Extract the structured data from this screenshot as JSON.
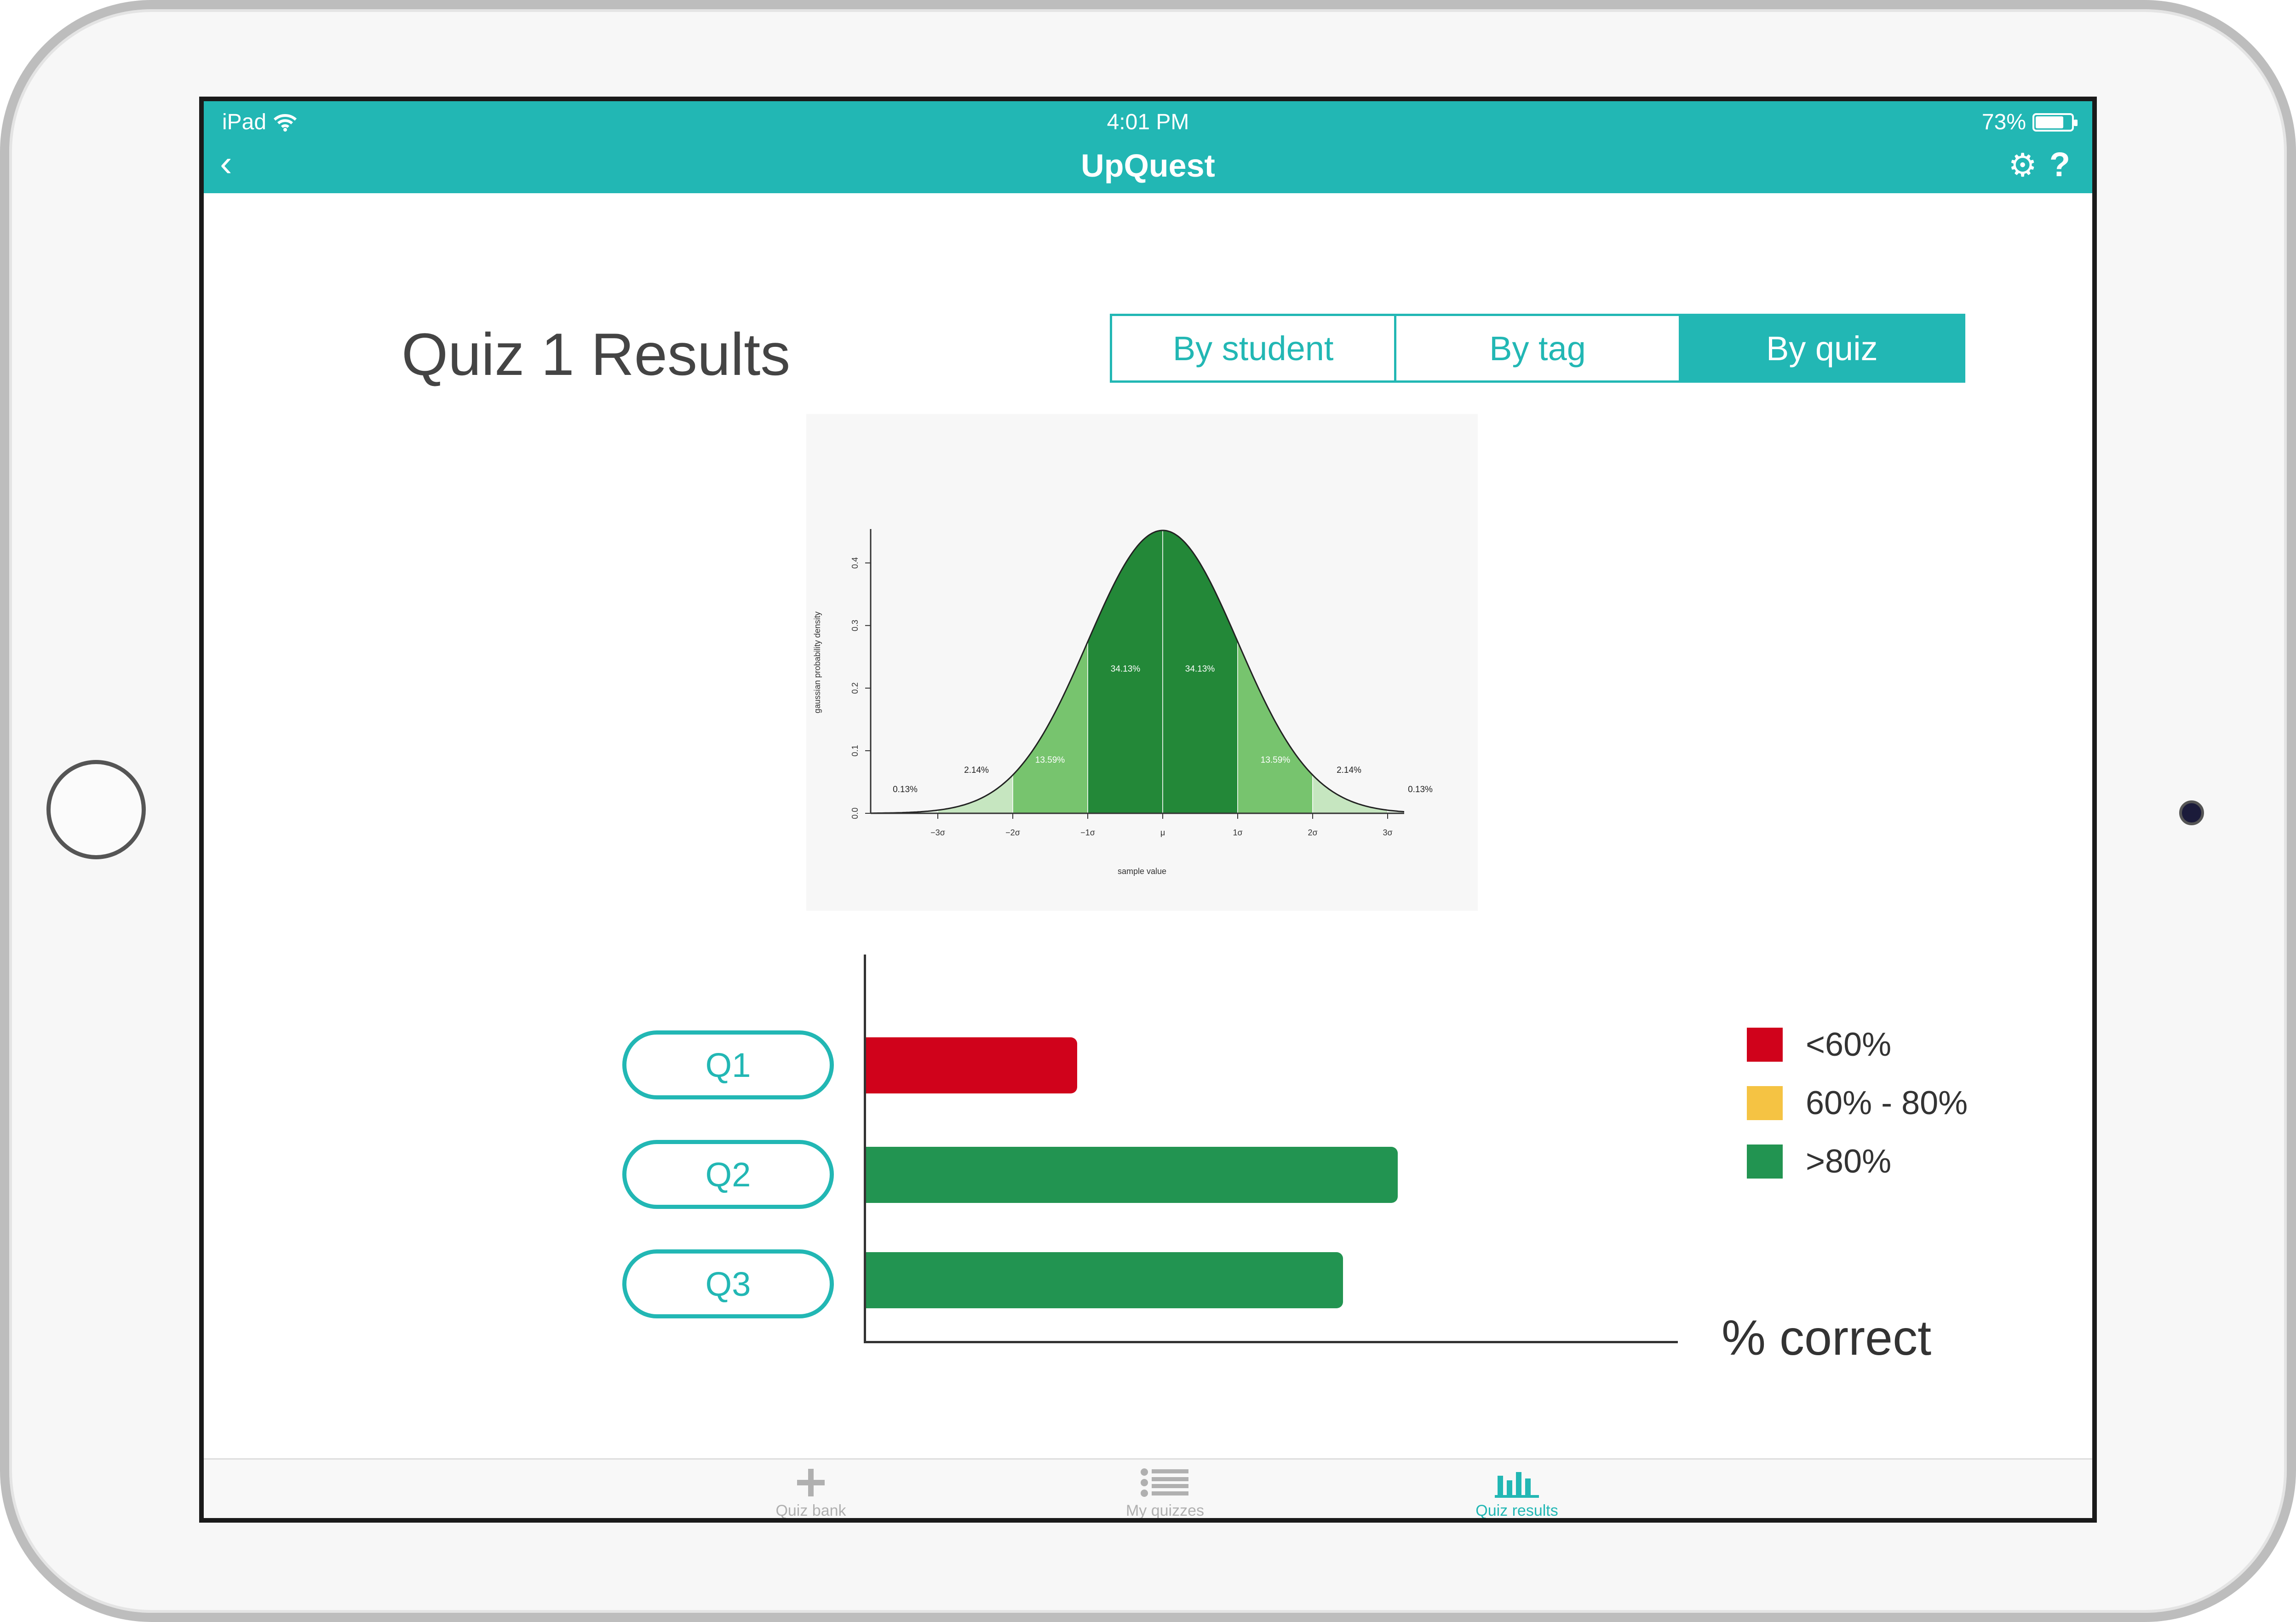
{
  "status_bar": {
    "carrier": "iPad",
    "time": "4:01 PM",
    "battery": "73%"
  },
  "nav": {
    "title": "UpQuest"
  },
  "page": {
    "title": "Quiz 1 Results"
  },
  "segments": [
    {
      "label": "By student",
      "active": false
    },
    {
      "label": "By tag",
      "active": false
    },
    {
      "label": "By quiz",
      "active": true
    }
  ],
  "bell_curve": {
    "ylabel": "gaussian probability density",
    "xlabel": "sample value",
    "yticks": [
      "0.0",
      "0.1",
      "0.2",
      "0.3",
      "0.4"
    ],
    "xticks": [
      "−3σ",
      "−2σ",
      "−1σ",
      "μ",
      "1σ",
      "2σ",
      "3σ"
    ],
    "region_labels": [
      "0.13%",
      "2.14%",
      "13.59%",
      "34.13%",
      "34.13%",
      "13.59%",
      "2.14%",
      "0.13%"
    ]
  },
  "questions": [
    "Q1",
    "Q2",
    "Q3"
  ],
  "chart_data": {
    "type": "bar",
    "orientation": "horizontal",
    "categories": [
      "Q1",
      "Q2",
      "Q3"
    ],
    "values": [
      27,
      68,
      61
    ],
    "colors": [
      "#d0021b",
      "#229451",
      "#229451"
    ],
    "xlabel": "% correct",
    "xlim": [
      0,
      100
    ],
    "legend": [
      {
        "label": "<60%",
        "color": "#d0021b"
      },
      {
        "label": "60% - 80%",
        "color": "#f5c343"
      },
      {
        "label": ">80%",
        "color": "#229451"
      }
    ],
    "legend_position": "right"
  },
  "tabbar": [
    {
      "label": "Quiz bank",
      "icon": "plus-icon",
      "active": false
    },
    {
      "label": "My quizzes",
      "icon": "list-icon",
      "active": false
    },
    {
      "label": "Quiz results",
      "icon": "bar-chart-icon",
      "active": true
    }
  ],
  "colors": {
    "accent": "#22b7b4",
    "red": "#d0021b",
    "yellow": "#f5c343",
    "green": "#229451"
  }
}
